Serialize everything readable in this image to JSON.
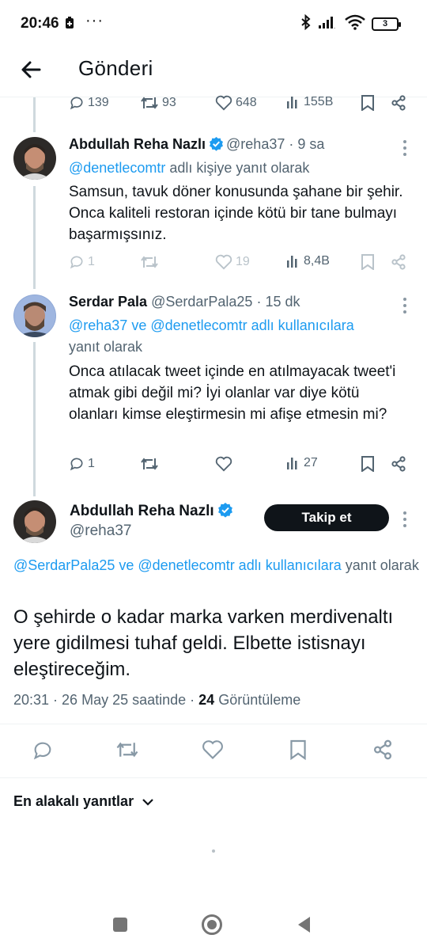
{
  "status_bar": {
    "time": "20:46",
    "dots": "···",
    "battery": "3"
  },
  "header": {
    "title": "Gönderi"
  },
  "prev_tweet_actions": {
    "replies": "139",
    "retweets": "93",
    "likes": "648",
    "views": "155B"
  },
  "tweets": [
    {
      "name": "Abdullah Reha Nazlı",
      "handle": "@reha37",
      "sep": "·",
      "time": "9 sa",
      "reply_link": "@denetlecomtr",
      "reply_suffix": " adlı kişiye yanıt olarak",
      "text": "Samsun, tavuk döner konusunda şahane bir şehir. Onca kaliteli restoran içinde kötü bir tane bulmayı başarmışsınız.",
      "replies": "1",
      "retweets": "",
      "likes": "19",
      "views": "8,4B"
    },
    {
      "name": "Serdar Pala",
      "handle": "@SerdarPala25",
      "sep": "·",
      "time": "15 dk",
      "reply_link": "@reha37 ve @denetlecomtr adlı kullanıcılara",
      "reply_suffix": "yanıt olarak",
      "text": "Onca atılacak tweet içinde en atılmayacak tweet'i atmak gibi değil mi? İyi olanlar var diye kötü olanları kimse eleştirmesin mi afişe etmesin mi?",
      "replies": "1",
      "retweets": "",
      "likes": "",
      "views": "27"
    }
  ],
  "focused_tweet": {
    "name": "Abdullah Reha Nazlı",
    "handle": "@reha37",
    "follow_label": "Takip et",
    "reply_link": "@SerdarPala25 ve @denetlecomtr adlı kullanıcılara",
    "reply_suffix": " yanıt olarak",
    "text": "O şehirde o kadar marka varken merdivenaltı yere gidilmesi tuhaf geldi. Elbette istisnayı eleştireceğim.",
    "time": "20:31",
    "date": "26 May 25 saatinde",
    "views_count": "24",
    "views_label": "Görüntüleme"
  },
  "replies_sort": {
    "label": "En alakalı yanıtlar"
  },
  "colors": {
    "link": "#1d9bf0",
    "verified": "#1d9bf0",
    "muted": "#536471"
  }
}
